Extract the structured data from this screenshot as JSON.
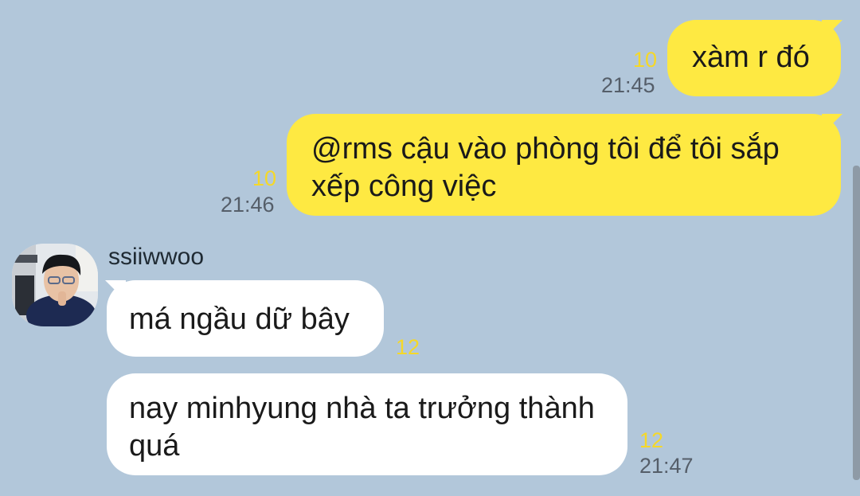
{
  "messages": [
    {
      "id": "m1",
      "from": "me",
      "text": "xàm r đó",
      "unread": "10",
      "time": "21:45"
    },
    {
      "id": "m2",
      "from": "me",
      "text": "@rms cậu vào phòng tôi để tôi sắp xếp công việc",
      "unread": "10",
      "time": "21:46"
    },
    {
      "id": "m3",
      "from": "ssiiwwoo",
      "text": "má ngầu dữ bây",
      "unread": "12",
      "time": ""
    },
    {
      "id": "m4",
      "from": "ssiiwwoo",
      "text": "nay minhyung nhà ta trưởng thành quá",
      "unread": "12",
      "time": "21:47"
    }
  ],
  "sender": {
    "name": "ssiiwwoo",
    "avatar": "profile-photo"
  },
  "colors": {
    "background": "#b2c7da",
    "my_bubble": "#fee942",
    "their_bubble": "#ffffff",
    "unread_count": "#f5d828"
  }
}
